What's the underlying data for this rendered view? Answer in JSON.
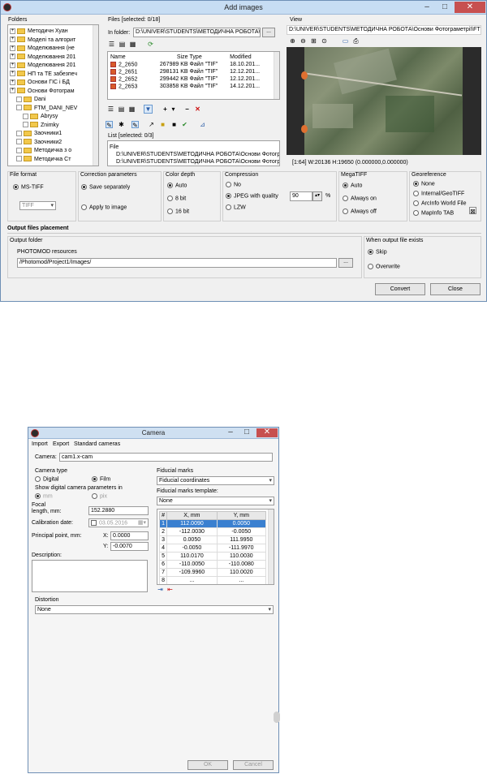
{
  "add_images": {
    "title": "Add images",
    "folders": {
      "label": "Folders",
      "items": [
        "Методичн Хуан",
        "Моделі та алгорит",
        "Моделювання (не",
        "Моделювання 201",
        "Моделювання 201",
        "НП та ТЕ забезпеч",
        "Основи ГІС і БД",
        "Основи Фотограм",
        "Dani",
        "FTM_DANI_NEV",
        "Abrysy",
        "Znimky",
        "Заочники1",
        "Заочники2",
        "Методичка з о",
        "Методичка Ст"
      ]
    },
    "files": {
      "label": "Files [selected: 0/18]",
      "in_folder_label": "In folder:",
      "in_folder_value": "D:\\UNIVER\\STUDENTS\\МЕТОДИЧНА РОБОТА\\Ос",
      "browse": "...",
      "columns": [
        "Name",
        "Size",
        "Type",
        "Modified"
      ],
      "rows": [
        [
          "2_2650",
          "267989 KB",
          "Файл \"TIF\"",
          "18.10.201..."
        ],
        [
          "2_2651",
          "298131 KB",
          "Файл \"TIF\"",
          "12.12.201..."
        ],
        [
          "2_2652",
          "299442 KB",
          "Файл \"TIF\"",
          "12.12.201..."
        ],
        [
          "2_2653",
          "303858 KB",
          "Файл \"TIF\"",
          "14.12.201..."
        ]
      ]
    },
    "list": {
      "label": "List [selected: 0/3]",
      "header": "File",
      "items": [
        "D:\\UNIVER\\STUDENTS\\МЕТОДИЧНА РОБОТА\\Основи Фотограм",
        "D:\\UNIVER\\STUDENTS\\МЕТОДИЧНА РОБОТА\\Основи Фотограм",
        "D:\\UNIVER\\STUDENTS\\МЕТОДИЧНА РОБОТА\\Основи Фотограм"
      ]
    },
    "view": {
      "label": "View",
      "path": "D:\\UNIVER\\STUDENTS\\МЕТОДИЧНА РОБОТА\\Основи Фотограметрії\\FTM_...",
      "status": "[1:64] W:20136 H:19650 (0.000000,0.000000)"
    },
    "file_format": {
      "label": "File format",
      "option": "MS-TIFF",
      "select": "TIFF"
    },
    "correction": {
      "label": "Correction parameters",
      "separately": "Save separately",
      "apply": "Apply to image"
    },
    "color_depth": {
      "label": "Color depth",
      "options": [
        "Auto",
        "8 bit",
        "16 bit"
      ]
    },
    "compression": {
      "label": "Compression",
      "options": [
        "No",
        "JPEG with quality",
        "LZW"
      ],
      "quality": "90",
      "unit": "%"
    },
    "megatiff": {
      "label": "MegaTIFF",
      "options": [
        "Auto",
        "Always on",
        "Always off"
      ]
    },
    "georeference": {
      "label": "Georeference",
      "options": [
        "None",
        "Internal/GeoTIFF",
        "ArcInfo World File",
        "MapInfo TAB"
      ]
    },
    "output": {
      "section": "Output files placement",
      "folder_label": "Output folder",
      "resources": "PHOTOMOD resources",
      "path": "/Photomod/Project1/Images/",
      "browse": "...",
      "exists_label": "When output file exists",
      "skip": "Skip",
      "overwrite": "Overwrite"
    },
    "convert": "Convert",
    "close": "Close"
  },
  "camera": {
    "title": "Camera",
    "menu": [
      "Import",
      "Export",
      "Standard cameras"
    ],
    "camera_label": "Camera:",
    "camera_value": "cam1.x-cam",
    "type_label": "Camera type",
    "digital": "Digital",
    "film": "Film",
    "show_params": "Show digital camera parameters in",
    "unit_mm": "mm",
    "unit_pix": "pix",
    "focal_label": "Focal\nlength, mm:",
    "focal_value": "152.2880",
    "calib_label": "Calibration date:",
    "calib_value": "03.05.2016",
    "pp_label": "Principal point, mm:",
    "x_label": "X:",
    "x_value": "0.0000",
    "y_label": "Y:",
    "y_value": "-0.0070",
    "desc_label": "Description:",
    "fid_label": "Fiducial marks",
    "fid_select": "Fiducial coordinates",
    "tmpl_label": "Fiducial marks template:",
    "tmpl_select": "None",
    "table_cols": [
      "#",
      "X, mm",
      "Y, mm"
    ],
    "table_rows": [
      [
        "1",
        "112.0090",
        "0.0050"
      ],
      [
        "2",
        "-112.0030",
        "-0.0050"
      ],
      [
        "3",
        "0.0050",
        "111.9950"
      ],
      [
        "4",
        "-0.0050",
        "-111.9970"
      ],
      [
        "5",
        "110.0170",
        "110.0030"
      ],
      [
        "6",
        "-110.0050",
        "-110.0080"
      ],
      [
        "7",
        "-109.9960",
        "110.0020"
      ],
      [
        "8",
        "...",
        "..."
      ]
    ],
    "distortion_label": "Distortion",
    "distortion_select": "None",
    "ok": "OK",
    "cancel": "Cancel"
  },
  "colors": {
    "accent": "#3a80d0",
    "titlebar": "#c7ddf3",
    "close": "#c75050"
  }
}
